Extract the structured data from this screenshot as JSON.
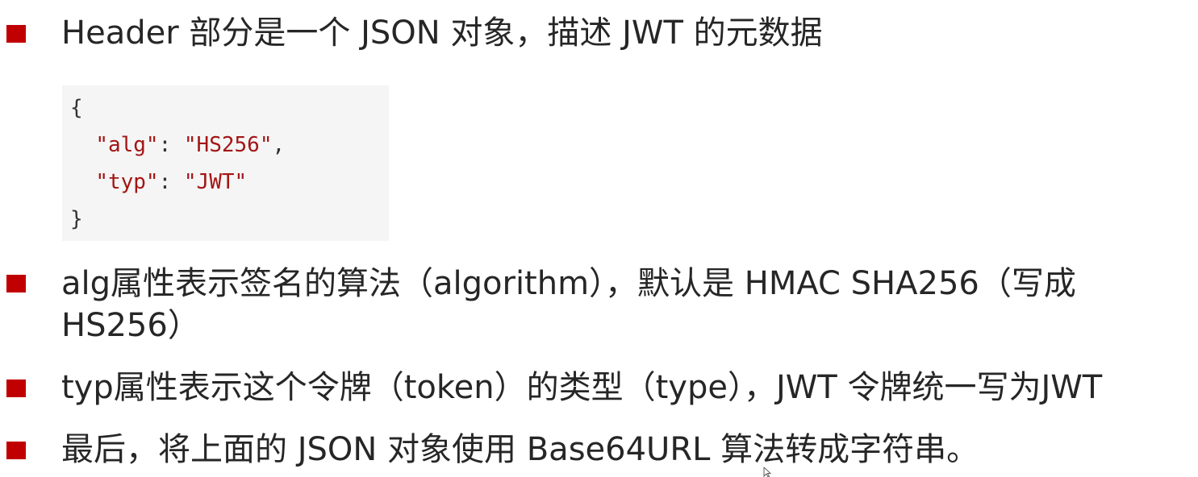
{
  "bullets": [
    "Header 部分是一个 JSON 对象，描述 JWT 的元数据",
    "alg属性表示签名的算法（algorithm），默认是 HMAC SHA256（写成",
    "HS256）",
    "typ属性表示这个令牌（token）的类型（type），JWT 令牌统一写为JWT",
    "最后，将上面的 JSON 对象使用 Base64URL 算法转成字符串。"
  ],
  "code": {
    "open_brace": "{",
    "line1_key": "\"alg\"",
    "line1_sep": ": ",
    "line1_val": "\"HS256\"",
    "line1_comma": ",",
    "line2_key": "\"typ\"",
    "line2_sep": ": ",
    "line2_val": "\"JWT\"",
    "close_brace": "}"
  },
  "colors": {
    "bullet": "#c00000",
    "code_string": "#a31515",
    "code_background": "#f5f5f5",
    "text": "#262626"
  },
  "icons": {
    "bullet": "square-bullet-icon",
    "cursor": "mouse-cursor-icon"
  }
}
